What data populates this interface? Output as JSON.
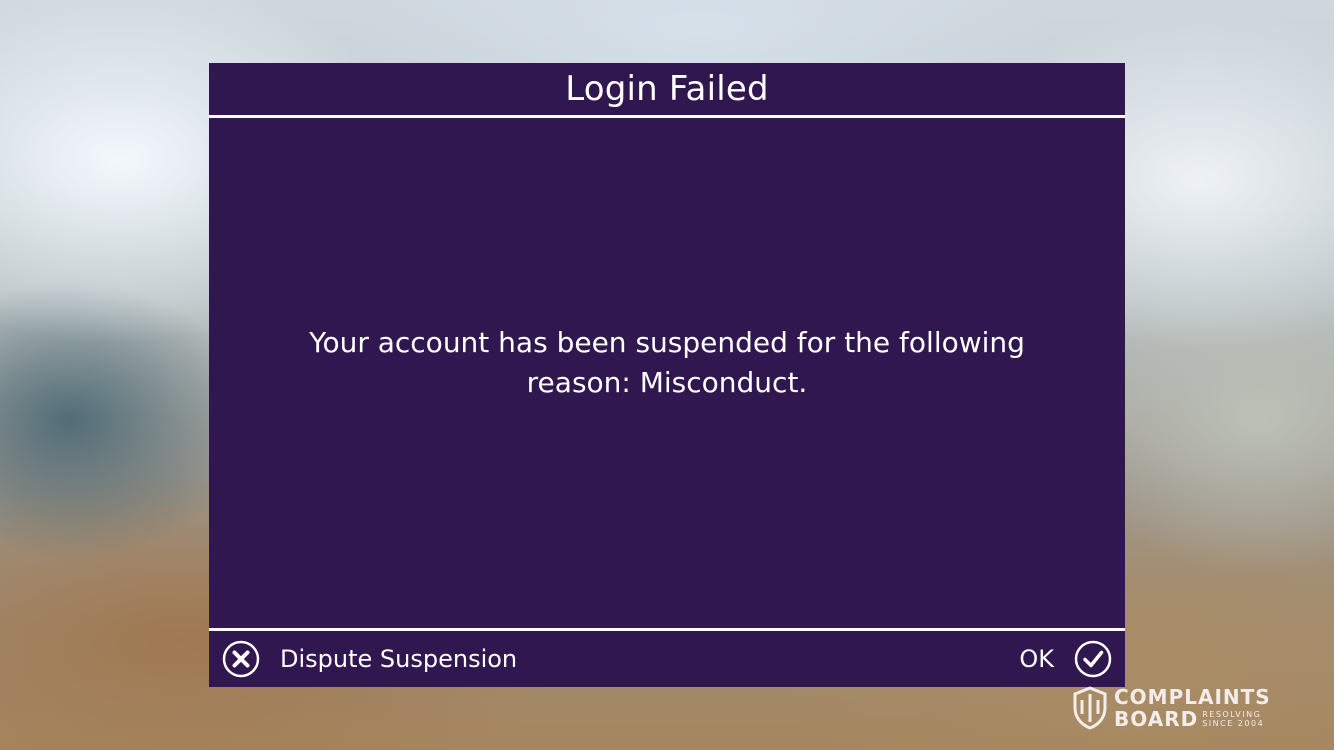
{
  "dialog": {
    "title": "Login Failed",
    "message": "Your account has been suspended for the following reason: Misconduct."
  },
  "footer": {
    "dispute_label": "Dispute Suspension",
    "dispute_icon": "close-circle-icon",
    "ok_label": "OK",
    "ok_icon": "check-circle-icon"
  },
  "watermark": {
    "line1": "COMPLAINTS",
    "line2": "BOARD",
    "tag1": "RESOLVING",
    "tag2": "SINCE 2004"
  },
  "colors": {
    "dialog_bg": "#31174f",
    "divider": "#ffffff",
    "text": "#ffffff"
  }
}
